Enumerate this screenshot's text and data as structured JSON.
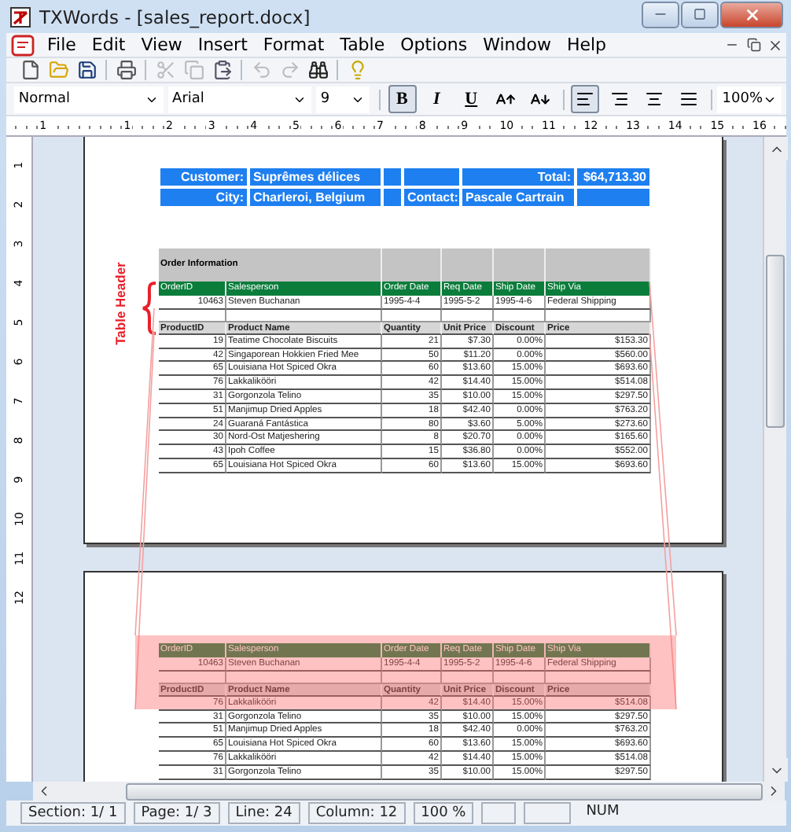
{
  "window": {
    "title": "TXWords - [sales_report.docx]"
  },
  "menu": [
    "File",
    "Edit",
    "View",
    "Insert",
    "Format",
    "Table",
    "Options",
    "Window",
    "Help"
  ],
  "toolbar": {
    "groups": [
      [
        {
          "kind": "new",
          "disabled": false
        },
        {
          "kind": "open",
          "disabled": false
        },
        {
          "kind": "save",
          "disabled": false
        }
      ],
      [
        {
          "kind": "print",
          "disabled": false
        }
      ],
      [
        {
          "kind": "cut",
          "disabled": true
        },
        {
          "kind": "copy",
          "disabled": true
        },
        {
          "kind": "paste",
          "disabled": false
        }
      ],
      [
        {
          "kind": "undo",
          "disabled": true
        },
        {
          "kind": "redo",
          "disabled": true
        },
        {
          "kind": "find",
          "disabled": false
        }
      ],
      [
        {
          "kind": "help",
          "disabled": false
        }
      ]
    ]
  },
  "format_bar": {
    "style": "Normal",
    "font": "Arial",
    "size": "9",
    "zoom": "100%",
    "text_buttons": [
      {
        "kind": "bold",
        "label": "B",
        "selected": true
      },
      {
        "kind": "italic",
        "label": "I",
        "selected": false
      },
      {
        "kind": "underline",
        "label": "U",
        "selected": false
      },
      {
        "kind": "grow",
        "selected": false
      },
      {
        "kind": "shrink",
        "selected": false
      }
    ],
    "align_buttons": [
      {
        "kind": "left",
        "selected": true
      },
      {
        "kind": "right",
        "selected": false
      },
      {
        "kind": "center",
        "selected": false
      },
      {
        "kind": "justify",
        "selected": false
      }
    ]
  },
  "ruler": {
    "labels": [
      "1",
      "1",
      "2",
      "3",
      "4",
      "5",
      "6",
      "7",
      "8",
      "9",
      "10",
      "11",
      "12",
      "13",
      "14",
      "15",
      "16"
    ]
  },
  "vertical_ruler": {
    "labels": [
      "1",
      "2",
      "3",
      "4",
      "5",
      "6",
      "7",
      "8",
      "9",
      "10",
      "11",
      "12"
    ]
  },
  "annotation": {
    "label": "Table Header"
  },
  "summary_table": {
    "rows": [
      {
        "label": "Customer:",
        "value": "Suprêmes délices",
        "right_label": "Total:",
        "right_value": "$64,713.30"
      },
      {
        "label": "City:",
        "value": "Charleroi, Belgium",
        "mid_label": "Contact:",
        "mid_value": "Pascale Cartrain"
      }
    ]
  },
  "pages": [
    {
      "title": "Order Information",
      "order_columns": [
        "OrderID",
        "Salesperson",
        "Order Date",
        "Req Date",
        "Ship Date",
        "Ship Via"
      ],
      "order_row": [
        "10463",
        "Steven Buchanan",
        "1995-4-4",
        "1995-5-2",
        "1995-4-6",
        "Federal Shipping"
      ],
      "product_columns": [
        "ProductID",
        "Product Name",
        "Quantity",
        "Unit Price",
        "Discount",
        "Price"
      ],
      "products": [
        [
          "19",
          "Teatime Chocolate Biscuits",
          "21",
          "$7.30",
          "0.00%",
          "$153.30"
        ],
        [
          "42",
          "Singaporean Hokkien Fried Mee",
          "50",
          "$11.20",
          "0.00%",
          "$560.00"
        ],
        [
          "65",
          "Louisiana Hot Spiced Okra",
          "60",
          "$13.60",
          "15.00%",
          "$693.60"
        ],
        [
          "76",
          "Lakkalikööri",
          "42",
          "$14.40",
          "15.00%",
          "$514.08"
        ],
        [
          "31",
          "Gorgonzola Telino",
          "35",
          "$10.00",
          "15.00%",
          "$297.50"
        ],
        [
          "51",
          "Manjimup Dried Apples",
          "18",
          "$42.40",
          "0.00%",
          "$763.20"
        ],
        [
          "24",
          "Guaraná Fantástica",
          "80",
          "$3.60",
          "5.00%",
          "$273.60"
        ],
        [
          "30",
          "Nord-Ost Matjeshering",
          "8",
          "$20.70",
          "0.00%",
          "$165.60"
        ],
        [
          "43",
          "Ipoh Coffee",
          "15",
          "$36.80",
          "0.00%",
          "$552.00"
        ],
        [
          "65",
          "Louisiana Hot Spiced Okra",
          "60",
          "$13.60",
          "15.00%",
          "$693.60"
        ]
      ]
    },
    {
      "highlighted": true,
      "order_columns": [
        "OrderID",
        "Salesperson",
        "Order Date",
        "Req Date",
        "Ship Date",
        "Ship Via"
      ],
      "order_row": [
        "10463",
        "Steven Buchanan",
        "1995-4-4",
        "1995-5-2",
        "1995-4-6",
        "Federal Shipping"
      ],
      "product_columns": [
        "ProductID",
        "Product Name",
        "Quantity",
        "Unit Price",
        "Discount",
        "Price"
      ],
      "products": [
        [
          "76",
          "Lakkalikööri",
          "42",
          "$14.40",
          "15.00%",
          "$514.08"
        ],
        [
          "31",
          "Gorgonzola Telino",
          "35",
          "$10.00",
          "15.00%",
          "$297.50"
        ],
        [
          "51",
          "Manjimup Dried Apples",
          "18",
          "$42.40",
          "0.00%",
          "$763.20"
        ],
        [
          "65",
          "Louisiana Hot Spiced Okra",
          "60",
          "$13.60",
          "15.00%",
          "$693.60"
        ],
        [
          "76",
          "Lakkalikööri",
          "42",
          "$14.40",
          "15.00%",
          "$514.08"
        ],
        [
          "31",
          "Gorgonzola Telino",
          "35",
          "$10.00",
          "15.00%",
          "$297.50"
        ]
      ]
    }
  ],
  "status_bar": [
    {
      "kind": "text",
      "text": "Section: 1/ 1"
    },
    {
      "kind": "text",
      "text": "Page: 1/ 3"
    },
    {
      "kind": "text",
      "text": "Line: 24"
    },
    {
      "kind": "text",
      "text": "Column: 12"
    },
    {
      "kind": "text",
      "text": "100 %"
    },
    {
      "kind": "blank"
    },
    {
      "kind": "blank"
    },
    {
      "kind": "indicator",
      "text": "NUM"
    }
  ]
}
